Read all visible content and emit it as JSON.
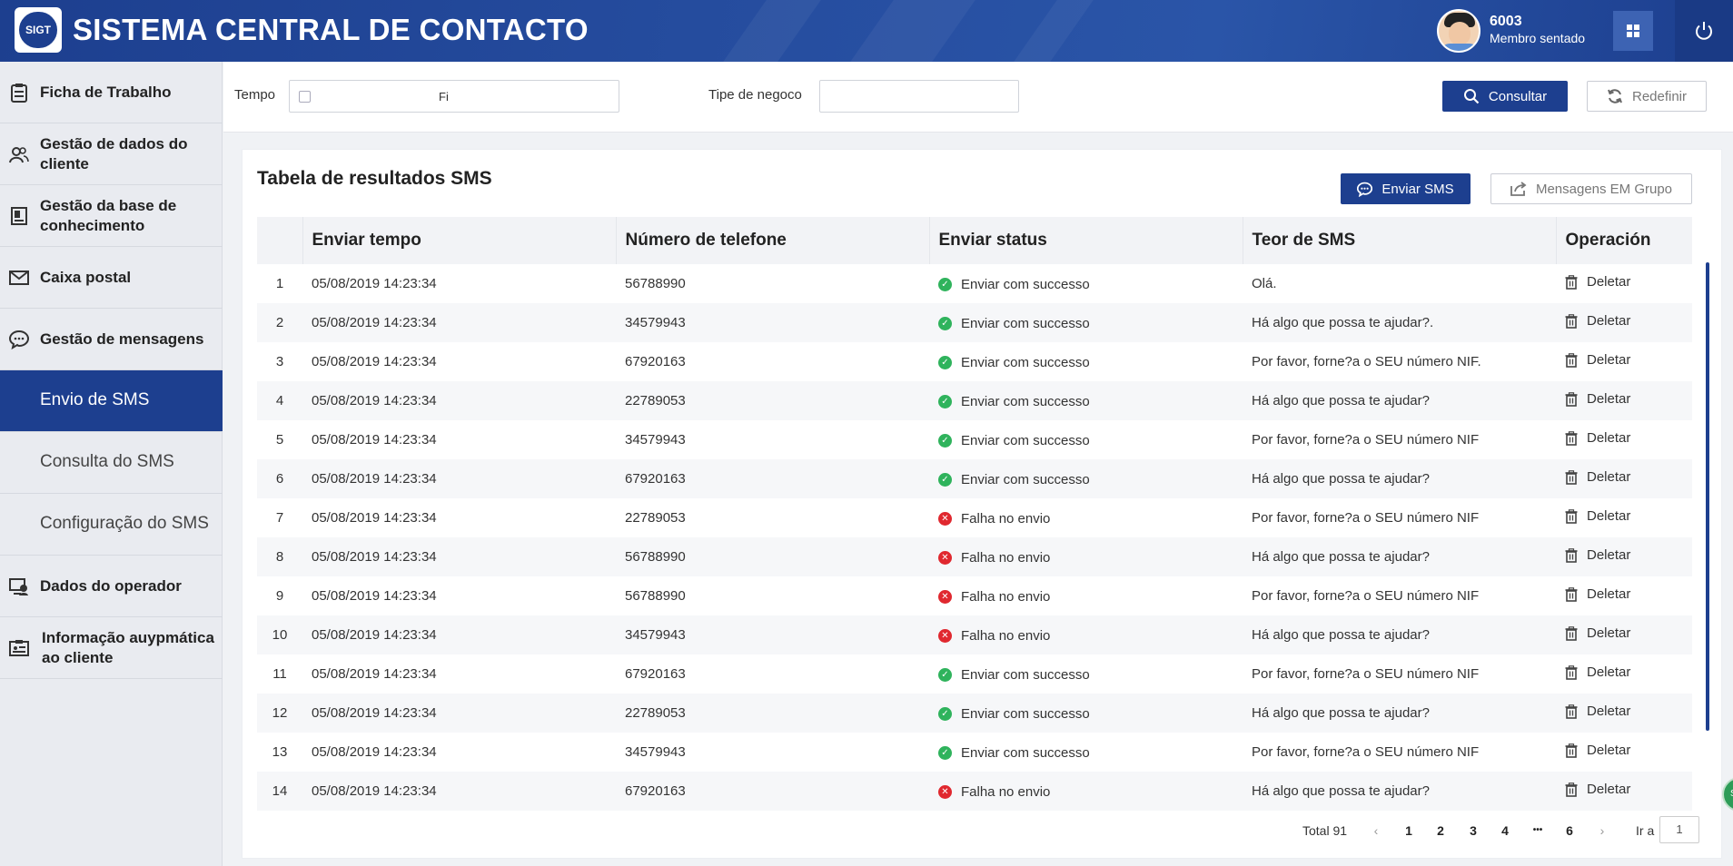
{
  "header": {
    "logo_text": "SIGT",
    "title": "SISTEMA CENTRAL DE CONTACTO",
    "user_id": "6003",
    "user_status": "Membro sentado"
  },
  "sidebar": {
    "items": [
      {
        "label": "Ficha de Trabalho",
        "icon": "clipboard-icon"
      },
      {
        "label": "Gestão de dados do cliente",
        "icon": "users-icon"
      },
      {
        "label": "Gestão da base de conhecimento",
        "icon": "book-icon"
      },
      {
        "label": "Caixa postal",
        "icon": "mail-icon"
      },
      {
        "label": "Gestão de mensagens",
        "icon": "chat-icon"
      },
      {
        "label": "Envio de SMS",
        "active": true
      },
      {
        "label": "Consulta do SMS"
      },
      {
        "label": "Configuração do SMS"
      },
      {
        "label": "Dados do operador",
        "icon": "operator-icon"
      },
      {
        "label": "Informação auypmática ao cliente",
        "icon": "id-card-icon"
      }
    ]
  },
  "filters": {
    "tempo_label": "Tempo",
    "tempo_value": "Fi",
    "tipe_label": "Tipe de negoco",
    "tipe_value": "",
    "consultar_label": "Consultar",
    "redefinir_label": "Redefinir"
  },
  "panel": {
    "title": "Tabela de resultados SMS",
    "send_label": "Enviar SMS",
    "group_label": "Mensagens EM Grupo"
  },
  "table": {
    "columns": [
      "",
      "Enviar tempo",
      "Número de telefone",
      "Enviar status",
      "Teor de SMS",
      "Operación"
    ],
    "rows": [
      {
        "n": "1",
        "time": "05/08/2019 14:23:34",
        "phone": "56788990",
        "status": "Enviar com successo",
        "ok": true,
        "msg": "Olá.",
        "op": "Deletar"
      },
      {
        "n": "2",
        "time": "05/08/2019 14:23:34",
        "phone": "34579943",
        "status": "Enviar com successo",
        "ok": true,
        "msg": "Há algo que possa te ajudar?.",
        "op": "Deletar"
      },
      {
        "n": "3",
        "time": "05/08/2019 14:23:34",
        "phone": "67920163",
        "status": "Enviar com successo",
        "ok": true,
        "msg": "Por favor, forne?a o SEU número NIF.",
        "op": "Deletar"
      },
      {
        "n": "4",
        "time": "05/08/2019 14:23:34",
        "phone": "22789053",
        "status": "Enviar com successo",
        "ok": true,
        "msg": "Há algo que possa te ajudar?",
        "op": "Deletar"
      },
      {
        "n": "5",
        "time": "05/08/2019 14:23:34",
        "phone": "34579943",
        "status": "Enviar com successo",
        "ok": true,
        "msg": "Por favor, forne?a o SEU número NIF",
        "op": "Deletar"
      },
      {
        "n": "6",
        "time": "05/08/2019 14:23:34",
        "phone": "67920163",
        "status": "Enviar com successo",
        "ok": true,
        "msg": "Há algo que possa te ajudar?",
        "op": "Deletar"
      },
      {
        "n": "7",
        "time": "05/08/2019 14:23:34",
        "phone": "22789053",
        "status": "Falha no envio",
        "ok": false,
        "msg": "Por favor, forne?a o SEU número NIF",
        "op": "Deletar"
      },
      {
        "n": "8",
        "time": "05/08/2019 14:23:34",
        "phone": "56788990",
        "status": "Falha no envio",
        "ok": false,
        "msg": "Há algo que possa te ajudar?",
        "op": "Deletar"
      },
      {
        "n": "9",
        "time": "05/08/2019 14:23:34",
        "phone": "56788990",
        "status": "Falha no envio",
        "ok": false,
        "msg": "Por favor, forne?a o SEU número NIF",
        "op": "Deletar"
      },
      {
        "n": "10",
        "time": "05/08/2019 14:23:34",
        "phone": "34579943",
        "status": "Falha no envio",
        "ok": false,
        "msg": "Há algo que possa te ajudar?",
        "op": "Deletar"
      },
      {
        "n": "11",
        "time": "05/08/2019 14:23:34",
        "phone": "67920163",
        "status": "Enviar com successo",
        "ok": true,
        "msg": "Por favor, forne?a o SEU número NIF",
        "op": "Deletar"
      },
      {
        "n": "12",
        "time": "05/08/2019 14:23:34",
        "phone": "22789053",
        "status": "Enviar com successo",
        "ok": true,
        "msg": "Há algo que possa te ajudar?",
        "op": "Deletar"
      },
      {
        "n": "13",
        "time": "05/08/2019 14:23:34",
        "phone": "34579943",
        "status": "Enviar com successo",
        "ok": true,
        "msg": "Por favor, forne?a o SEU número NIF",
        "op": "Deletar"
      },
      {
        "n": "14",
        "time": "05/08/2019 14:23:34",
        "phone": "67920163",
        "status": "Falha no envio",
        "ok": false,
        "msg": "Há algo que possa te ajudar?",
        "op": "Deletar"
      }
    ]
  },
  "pagination": {
    "total": "Total 91",
    "pages": [
      "1",
      "2",
      "3",
      "4",
      "•••",
      "6"
    ],
    "goto_label": "Ir a",
    "goto_value": "1"
  },
  "colors": {
    "brand": "#1d3f8f",
    "success": "#2fb35c",
    "error": "#e0282f"
  }
}
